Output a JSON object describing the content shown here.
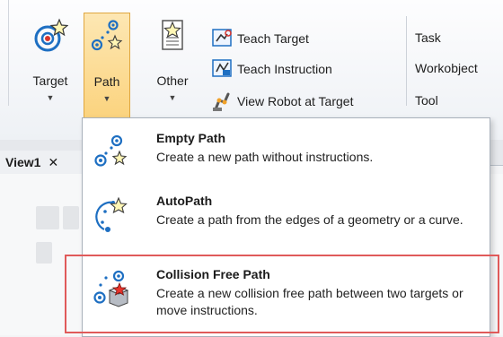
{
  "ribbon": {
    "target": {
      "label": "Target",
      "icon": "target-star-icon"
    },
    "path": {
      "label": "Path",
      "icon": "path-icon"
    },
    "other": {
      "label": "Other",
      "icon": "other-document-icon"
    },
    "teach_target": {
      "label": "Teach Target",
      "icon": "teach-target-icon"
    },
    "teach_instruction": {
      "label": "Teach Instruction",
      "icon": "teach-instruction-icon"
    },
    "view_robot": {
      "label": "View Robot at Target",
      "icon": "view-robot-icon"
    },
    "task": "Task",
    "workobject": "Workobject",
    "tool": "Tool"
  },
  "document": {
    "tab_label": "View1",
    "close_glyph": "✕"
  },
  "menu": {
    "items": [
      {
        "title": "Empty Path",
        "description": "Create a new path without instructions.",
        "icon": "empty-path-icon"
      },
      {
        "title": "AutoPath",
        "description": "Create a path from the edges of a geometry or a curve.",
        "icon": "autopath-icon"
      },
      {
        "title": "Collision Free Path",
        "description": "Create a new collision free path between two targets or move instructions.",
        "icon": "collision-free-path-icon"
      }
    ]
  },
  "colors": {
    "active_button": "#fbd37e",
    "highlight_border": "#e05a5a",
    "icon_blue": "#1e6fc2"
  }
}
